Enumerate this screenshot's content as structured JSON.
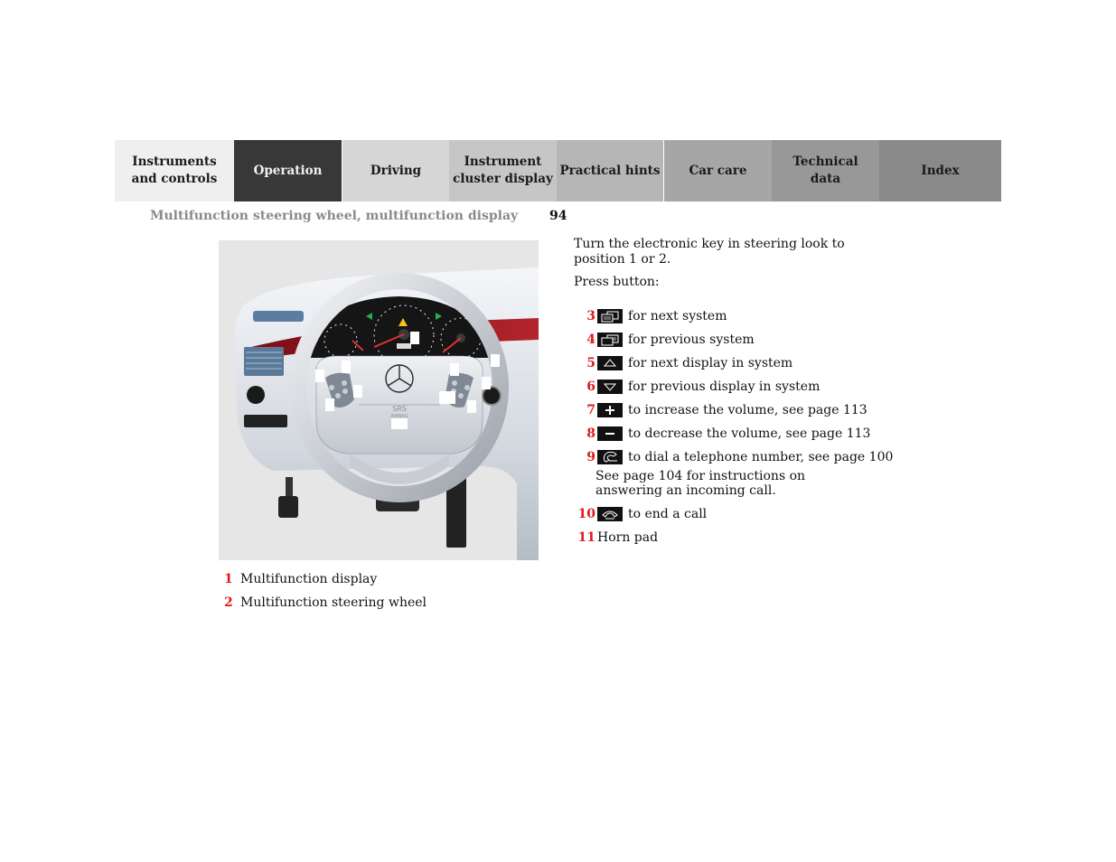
{
  "tabs": [
    {
      "label": "Instruments\nand controls"
    },
    {
      "label": "Operation",
      "active": true
    },
    {
      "label": "Driving"
    },
    {
      "label": "Instrument\ncluster display"
    },
    {
      "label": "Practical hints"
    },
    {
      "label": "Car care"
    },
    {
      "label": "Technical\ndata"
    },
    {
      "label": "Index"
    }
  ],
  "header": {
    "section_title": "Multifunction steering wheel, multifunction display",
    "page_number": "94"
  },
  "figure": {
    "description": "Dashboard illustration with multifunction steering wheel",
    "airbag_label_top": "SRS",
    "airbag_label_bottom": "AIRBAG",
    "captions": [
      {
        "num": "1",
        "text": "Multifunction display"
      },
      {
        "num": "2",
        "text": "Multifunction steering wheel"
      }
    ]
  },
  "instructions": {
    "intro": "Turn the electronic key in steering look to position 1 or 2.",
    "press": "Press button:",
    "items": [
      {
        "num": "3",
        "icon": "next-system-icon",
        "text": "for next system"
      },
      {
        "num": "4",
        "icon": "previous-system-icon",
        "text": "for previous system"
      },
      {
        "num": "5",
        "icon": "up-arrow-icon",
        "text": "for next display in system"
      },
      {
        "num": "6",
        "icon": "down-arrow-icon",
        "text": "for previous display in system"
      },
      {
        "num": "7",
        "icon": "plus-icon",
        "text": "to increase the volume, see page 113"
      },
      {
        "num": "8",
        "icon": "minus-icon",
        "text": "to decrease the volume, see page 113"
      },
      {
        "num": "9",
        "icon": "phone-dial-icon",
        "text": "to dial a telephone number, see page 100"
      }
    ],
    "note": "See page 104 for instructions on answering an incoming call.",
    "items_after": [
      {
        "num": "10",
        "icon": "phone-hangup-icon",
        "text": "to end a call"
      },
      {
        "num": "11",
        "text": "Horn pad"
      }
    ]
  },
  "colors": {
    "accent_number": "#e01a1a",
    "active_tab": "#383838",
    "section_title": "#8a8a8a"
  }
}
